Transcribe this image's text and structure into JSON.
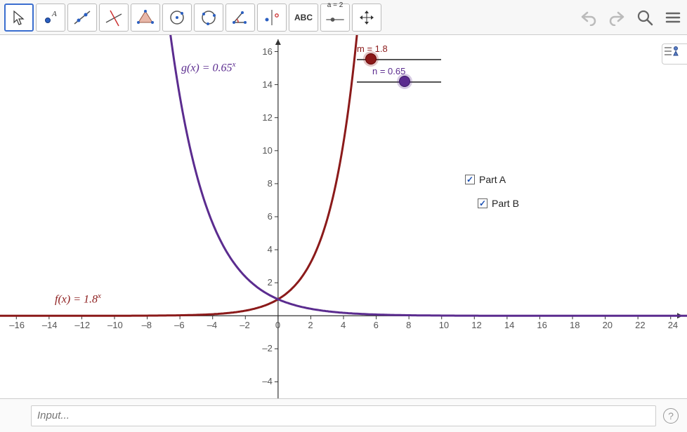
{
  "toolbar": {
    "tools": [
      {
        "name": "move-tool",
        "icon": "cursor"
      },
      {
        "name": "point-tool",
        "icon": "point"
      },
      {
        "name": "line-tool",
        "icon": "line"
      },
      {
        "name": "perpendicular-tool",
        "icon": "perp"
      },
      {
        "name": "polygon-tool",
        "icon": "polygon"
      },
      {
        "name": "circle-center-tool",
        "icon": "circle1"
      },
      {
        "name": "circle-3pt-tool",
        "icon": "circle2"
      },
      {
        "name": "angle-tool",
        "icon": "angle"
      },
      {
        "name": "reflect-tool",
        "icon": "reflect"
      },
      {
        "name": "text-tool",
        "icon": "abc"
      },
      {
        "name": "slider-tool",
        "icon": "slider"
      },
      {
        "name": "move-view-tool",
        "icon": "movev"
      }
    ],
    "selected_index": 0,
    "abc_label": "ABC",
    "slider_label_top": "a = 2"
  },
  "graph": {
    "f_label": "f(x)  =  1.8",
    "f_exp": "x",
    "g_label": "g(x)  =  0.65",
    "g_exp": "x",
    "x_ticks": [
      -16,
      -14,
      -12,
      -10,
      -8,
      -6,
      -4,
      -2,
      0,
      2,
      4,
      6,
      8,
      10,
      12,
      14,
      16,
      18,
      20,
      22,
      24
    ],
    "y_ticks": [
      -4,
      -2,
      2,
      4,
      6,
      8,
      10,
      12,
      14,
      16
    ]
  },
  "sliders": {
    "m": {
      "label": "m = 1.8",
      "value": 1.8,
      "min": 0,
      "max": 5
    },
    "n": {
      "label": "n = 0.65",
      "value": 0.65,
      "min": 0,
      "max": 5
    }
  },
  "checkboxes": {
    "a": {
      "label": "Part A",
      "checked": true
    },
    "b": {
      "label": "Part B",
      "checked": true
    }
  },
  "inputbar": {
    "placeholder": "Input..."
  },
  "chart_data": {
    "type": "line",
    "title": "",
    "xlabel": "",
    "ylabel": "",
    "xlim": [
      -17,
      25
    ],
    "ylim": [
      -5,
      17
    ],
    "series": [
      {
        "name": "f(x) = 1.8^x",
        "color": "#8b1a1a",
        "expr": "1.8^x",
        "x": [
          -16,
          -12,
          -8,
          -4,
          -2,
          0,
          1,
          2,
          3,
          4,
          4.5,
          4.8
        ],
        "y": [
          8.24e-05,
          0.000857,
          0.00892,
          0.0953,
          0.309,
          1,
          1.8,
          3.24,
          5.832,
          10.4976,
          14.08,
          16.8
        ]
      },
      {
        "name": "g(x) = 0.65^x",
        "color": "#5b2c8f",
        "expr": "0.65^x",
        "x": [
          -6.5,
          -6,
          -5,
          -4,
          -3,
          -2,
          -1,
          0,
          2,
          4,
          8,
          12,
          16,
          24
        ],
        "y": [
          16.45,
          11.33,
          7.36,
          5.6,
          3.64,
          2.37,
          1.54,
          1,
          0.423,
          0.179,
          0.0319,
          0.00569,
          0.00102,
          3.23e-05
        ]
      }
    ],
    "sliders": [
      {
        "name": "m",
        "value": 1.8,
        "min": 0,
        "max": 5
      },
      {
        "name": "n",
        "value": 0.65,
        "min": 0,
        "max": 5
      }
    ],
    "checkboxes": [
      {
        "name": "Part A",
        "checked": true
      },
      {
        "name": "Part B",
        "checked": true
      }
    ]
  }
}
